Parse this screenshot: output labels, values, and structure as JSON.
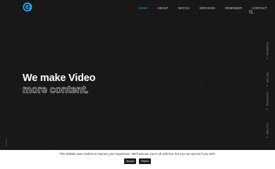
{
  "nav": {
    "items": [
      "HOME",
      "ABOUT",
      "WATCH",
      "SERVICES",
      "REMINDER",
      "CONTACT"
    ],
    "active_index": 0
  },
  "hero": {
    "line1": "We make Video",
    "line2": "more content."
  },
  "social": {
    "items": [
      "FACEBOOK",
      "TWITTER",
      "INSTAGRAM",
      "YOUTUBE"
    ]
  },
  "scroll_label": "SCROLL",
  "cookie": {
    "text": "This website uses cookies to improve your experience. We'll assume you're ok with this, but you can opt-out if you wish.",
    "accept_label": "Accept",
    "reject_label": "Reject"
  },
  "colors": {
    "background": "#161616",
    "accent": "#1ea5e8",
    "cookie_background": "#ffffff"
  },
  "icons": {
    "logo": "brand-logo-icon",
    "search": "search-icon"
  }
}
